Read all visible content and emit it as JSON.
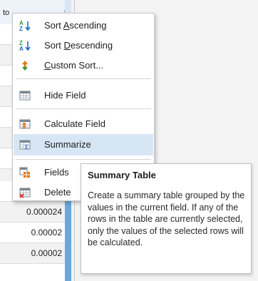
{
  "table": {
    "column_header": "to",
    "cells": [
      "",
      "",
      "",
      "",
      "",
      "",
      "",
      "",
      "",
      "0.000024",
      "0.000024",
      "0.00002",
      "0.00002"
    ]
  },
  "menu": {
    "items": [
      {
        "label_pre": "Sort ",
        "mnemonic": "A",
        "label_post": "scending",
        "icon": "sort-ascending-icon"
      },
      {
        "label_pre": "Sort ",
        "mnemonic": "D",
        "label_post": "escending",
        "icon": "sort-descending-icon"
      },
      {
        "label_pre": "",
        "mnemonic": "C",
        "label_post": "ustom Sort...",
        "icon": "custom-sort-icon"
      },
      {
        "label": "Hide Field",
        "icon": "hide-field-icon"
      },
      {
        "label": "Calculate Field",
        "icon": "calculate-field-icon"
      },
      {
        "label": "Summarize",
        "icon": "summarize-icon",
        "hovered": true
      },
      {
        "label": "Fields",
        "icon": "fields-icon"
      },
      {
        "label": "Delete",
        "icon": "delete-field-icon"
      }
    ]
  },
  "tooltip": {
    "title": "Summary Table",
    "body": "Create a summary table grouped by the values in the current field. If any of the rows in the table are currently selected, only the values of the selected rows will be calculated."
  },
  "colors": {
    "accent": "#6aa7de",
    "hover": "#d7e6f5",
    "green_arrow": "#2c9c3b",
    "blue_letter": "#1b6ac9",
    "orange_sort": "#e07b1a"
  }
}
